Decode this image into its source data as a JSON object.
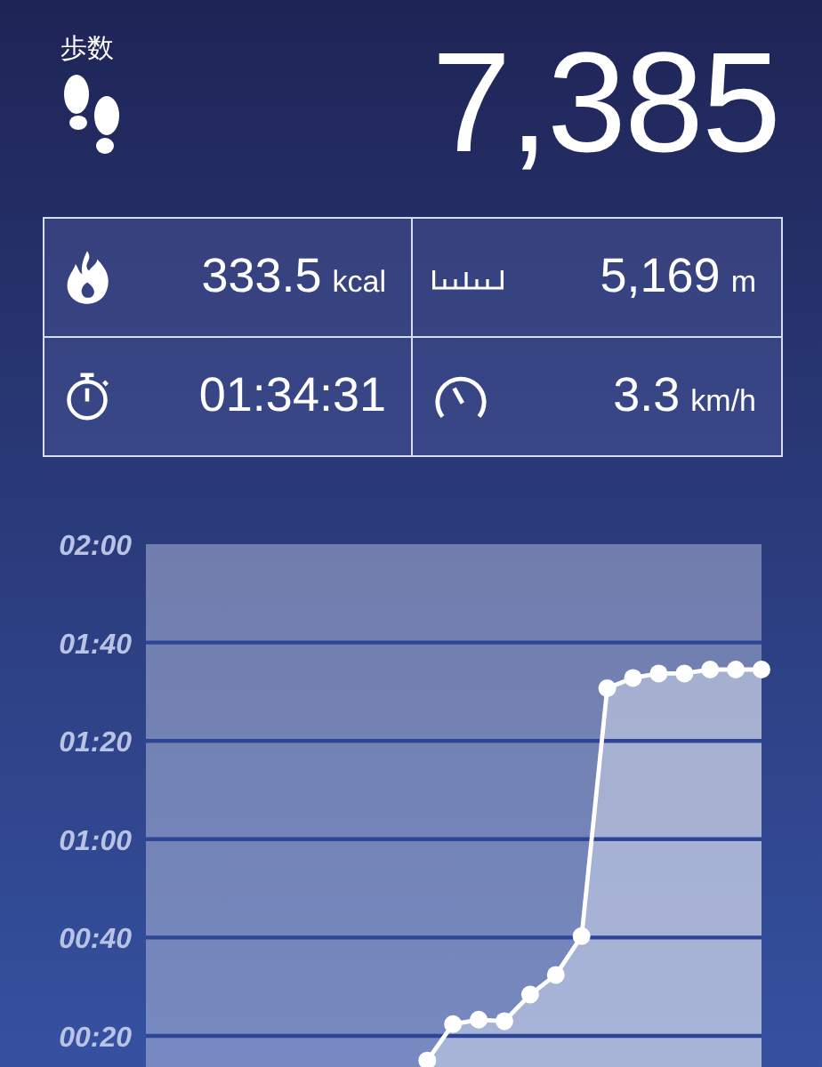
{
  "steps": {
    "label": "歩数",
    "value": "7,385"
  },
  "stats": [
    {
      "kind": "calories",
      "value": "333.5",
      "unit": "kcal"
    },
    {
      "kind": "distance",
      "value": "5,169",
      "unit": "m"
    },
    {
      "kind": "time",
      "value": "01:34:31"
    },
    {
      "kind": "speed",
      "value": "3.3",
      "unit": "km/h"
    }
  ],
  "chart": {
    "chart_data": {
      "type": "area",
      "grid": true,
      "ylim": [
        0,
        120
      ],
      "yticks": [
        {
          "value": 20,
          "label": "00:20"
        },
        {
          "value": 40,
          "label": "00:40"
        },
        {
          "value": 60,
          "label": "01:00"
        },
        {
          "value": 80,
          "label": "01:20"
        },
        {
          "value": 100,
          "label": "01:40"
        },
        {
          "value": 120,
          "label": "02:00"
        }
      ],
      "values": [
        15,
        22.4,
        23.3,
        23,
        28.4,
        32.4,
        40.3,
        90.7,
        92.8,
        93.7,
        93.7,
        94.5,
        94.5,
        94.5
      ]
    }
  }
}
